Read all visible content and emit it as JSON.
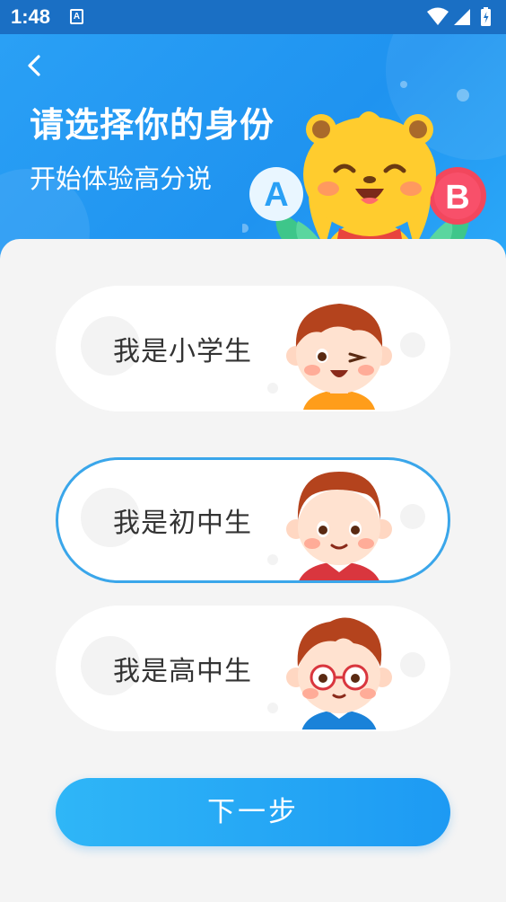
{
  "status_bar": {
    "time": "1:48",
    "notification_icon": "A",
    "icons": [
      "wifi-icon",
      "signal-icon",
      "battery-icon"
    ]
  },
  "header": {
    "back_icon": "chevron-left-icon",
    "title": "请选择你的身份",
    "subtitle": "开始体验高分说",
    "mascot_badges": [
      "A",
      "B"
    ]
  },
  "options": [
    {
      "label": "我是小学生",
      "avatar": "primary-student-avatar",
      "selected": false
    },
    {
      "label": "我是初中生",
      "avatar": "middle-student-avatar",
      "selected": true
    },
    {
      "label": "我是高中生",
      "avatar": "high-student-avatar",
      "selected": false
    }
  ],
  "next_button": {
    "label": "下一步"
  },
  "colors": {
    "header_blue": "#1f93f0",
    "status_bar": "#1a6fc4",
    "selected_border": "#3aa6ea",
    "button_gradient_start": "#2fb6f7",
    "button_gradient_end": "#1d9af3"
  }
}
